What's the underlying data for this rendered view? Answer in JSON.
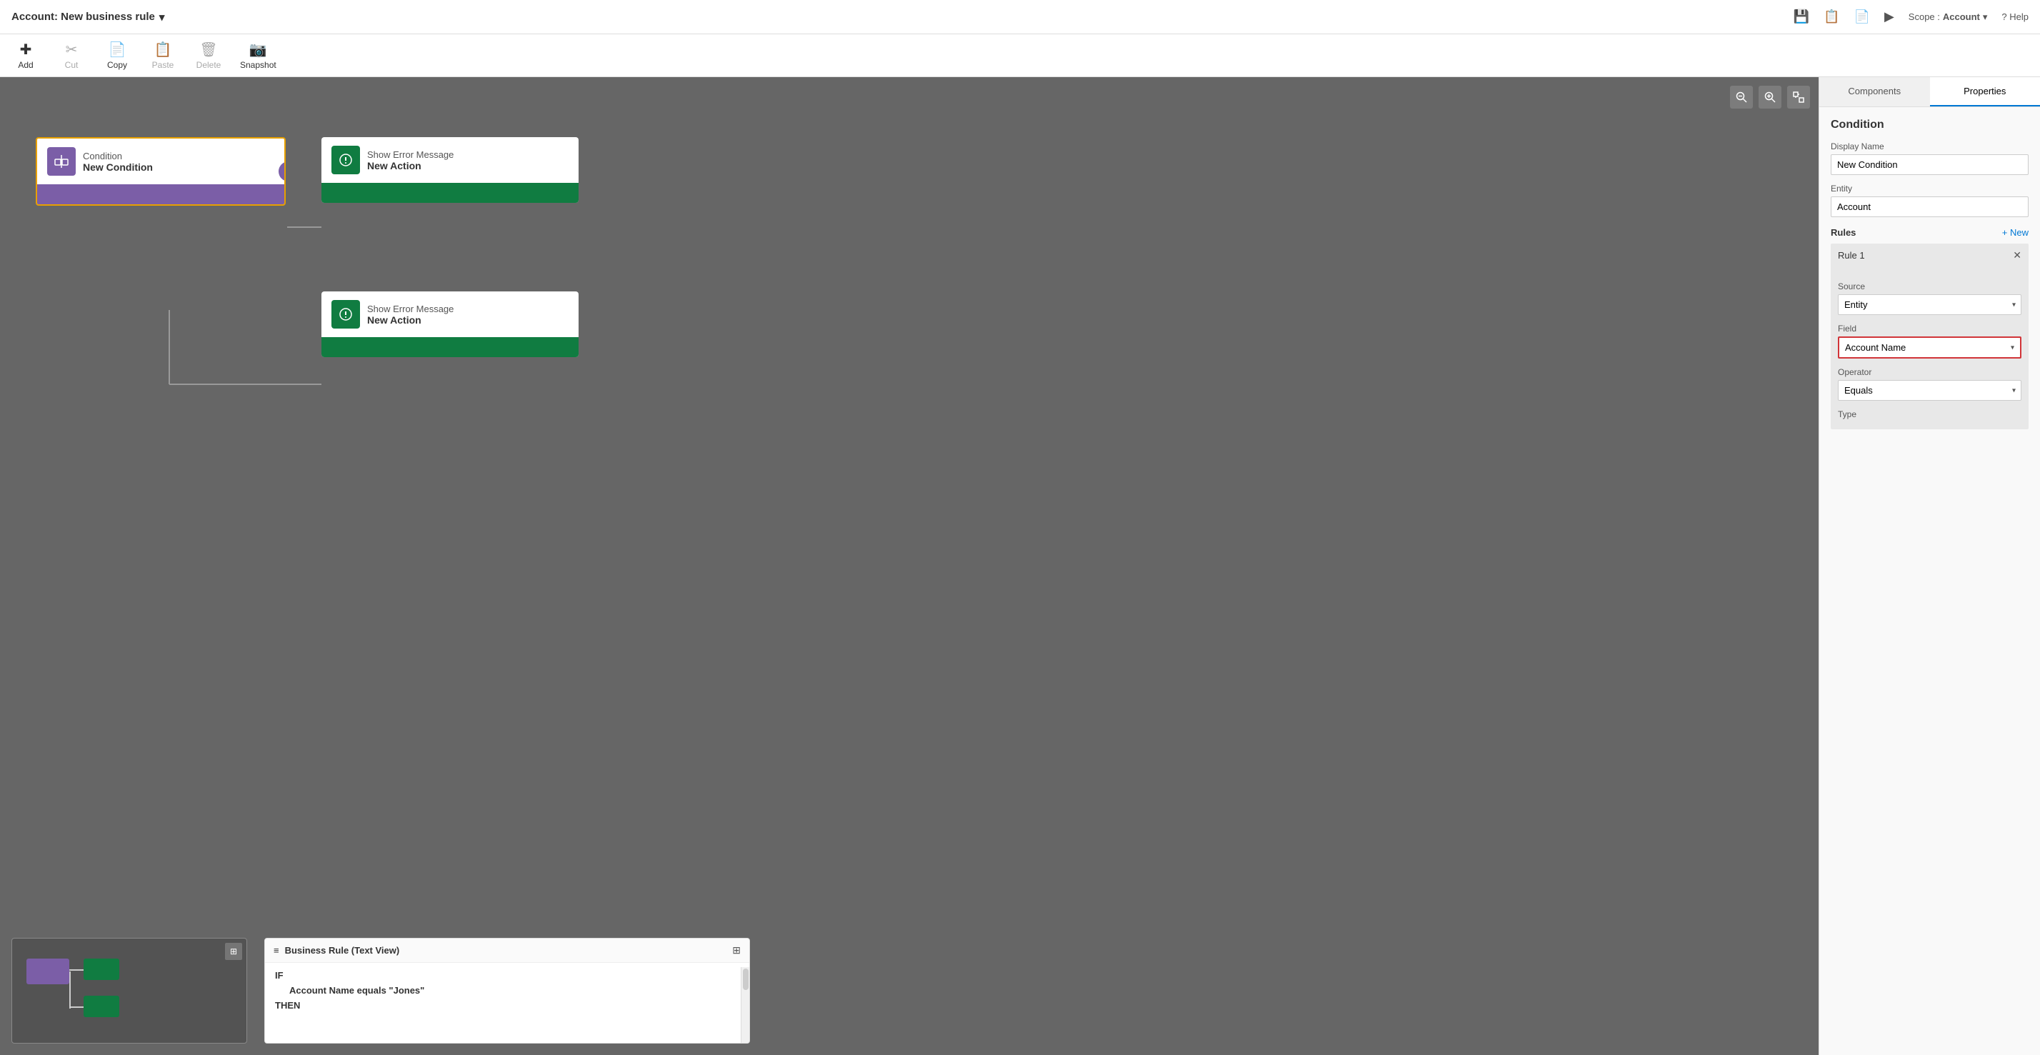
{
  "titleBar": {
    "title": "Account: New business rule",
    "dropdownArrow": "▾",
    "actions": [
      {
        "name": "save-icon",
        "label": "💾"
      },
      {
        "name": "rules-icon",
        "label": "📋"
      },
      {
        "name": "check-icon",
        "label": "📄"
      },
      {
        "name": "play-icon",
        "label": "▶"
      }
    ],
    "scope_label": "Scope :",
    "scope_value": "Account",
    "help_label": "? Help"
  },
  "toolbar": {
    "items": [
      {
        "name": "add-button",
        "icon": "+",
        "label": "Add"
      },
      {
        "name": "cut-button",
        "icon": "✂",
        "label": "Cut"
      },
      {
        "name": "copy-button",
        "icon": "📄",
        "label": "Copy"
      },
      {
        "name": "paste-button",
        "icon": "📋",
        "label": "Paste"
      },
      {
        "name": "delete-button",
        "icon": "🗑",
        "label": "Delete"
      },
      {
        "name": "snapshot-button",
        "icon": "📷",
        "label": "Snapshot"
      }
    ]
  },
  "canvas": {
    "zoomOut": "🔍",
    "zoomIn": "🔍",
    "expand": "⊞",
    "conditionNode": {
      "label": "Condition",
      "name": "New Condition"
    },
    "actionNode1": {
      "label": "Show Error Message",
      "name": "New Action"
    },
    "actionNode2": {
      "label": "Show Error Message",
      "name": "New Action"
    },
    "textView": {
      "title": "Business Rule (Text View)",
      "if_keyword": "IF",
      "condition_text": "Account Name equals \"Jones\"",
      "then_keyword": "THEN"
    }
  },
  "rightPanel": {
    "tabs": [
      {
        "name": "components-tab",
        "label": "Components"
      },
      {
        "name": "properties-tab",
        "label": "Properties"
      }
    ],
    "activeTab": "Properties",
    "sectionTitle": "Condition",
    "displayNameLabel": "Display Name",
    "displayNameValue": "New Condition",
    "entityLabel": "Entity",
    "entityValue": "Account",
    "rulesLabel": "Rules",
    "newLink": "+ New",
    "rule": {
      "title": "Rule 1",
      "sourceLabel": "Source",
      "sourceValue": "Entity",
      "fieldLabel": "Field",
      "fieldValue": "Account Name",
      "operatorLabel": "Operator",
      "operatorValue": "Equals",
      "typeLabel": "Type"
    }
  }
}
